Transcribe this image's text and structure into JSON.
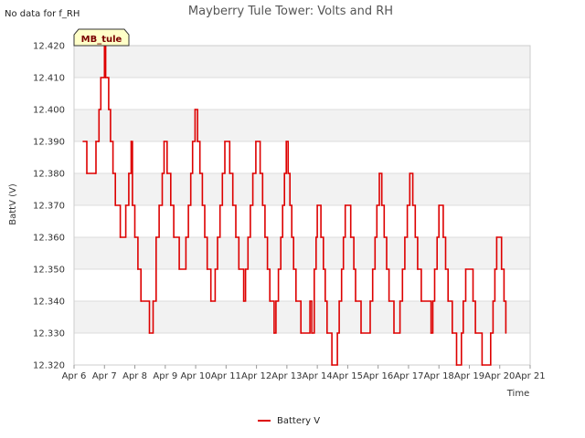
{
  "note": "No data for f_RH",
  "tag": "MB_tule",
  "colors": {
    "series": "#dd0000",
    "band": "#f2f2f2",
    "grid": "#dcdcdc",
    "tag_fill": "#ffffc8"
  },
  "chart_data": {
    "type": "line",
    "title": "Mayberry Tule Tower: Volts and RH",
    "xlabel": "Time",
    "ylabel": "BattV (V)",
    "x_ticks": [
      "Apr 6",
      "Apr 7",
      "Apr 8",
      "Apr 9",
      "Apr 10",
      "Apr 11",
      "Apr 12",
      "Apr 13",
      "Apr 14",
      "Apr 15",
      "Apr 16",
      "Apr 17",
      "Apr 18",
      "Apr 19",
      "Apr 20",
      "Apr 21"
    ],
    "xlim": [
      6,
      21
    ],
    "ylim": [
      12.32,
      12.42
    ],
    "y_ticks": [
      "12.320",
      "12.330",
      "12.340",
      "12.350",
      "12.360",
      "12.370",
      "12.380",
      "12.390",
      "12.400",
      "12.410",
      "12.420"
    ],
    "grid": true,
    "legend_position": "bottom-center",
    "series": [
      {
        "name": "Battery V",
        "x_unit": "day of April",
        "points": [
          [
            6.3,
            12.39
          ],
          [
            6.4,
            12.39
          ],
          [
            6.42,
            12.38
          ],
          [
            6.7,
            12.38
          ],
          [
            6.72,
            12.39
          ],
          [
            6.8,
            12.39
          ],
          [
            6.82,
            12.4
          ],
          [
            6.88,
            12.41
          ],
          [
            6.96,
            12.41
          ],
          [
            7.0,
            12.42
          ],
          [
            7.04,
            12.41
          ],
          [
            7.1,
            12.41
          ],
          [
            7.14,
            12.4
          ],
          [
            7.2,
            12.39
          ],
          [
            7.28,
            12.38
          ],
          [
            7.36,
            12.37
          ],
          [
            7.52,
            12.36
          ],
          [
            7.7,
            12.37
          ],
          [
            7.8,
            12.38
          ],
          [
            7.88,
            12.39
          ],
          [
            7.92,
            12.37
          ],
          [
            8.0,
            12.36
          ],
          [
            8.1,
            12.35
          ],
          [
            8.2,
            12.34
          ],
          [
            8.48,
            12.33
          ],
          [
            8.6,
            12.34
          ],
          [
            8.7,
            12.36
          ],
          [
            8.8,
            12.37
          ],
          [
            8.9,
            12.38
          ],
          [
            8.96,
            12.39
          ],
          [
            9.06,
            12.38
          ],
          [
            9.18,
            12.37
          ],
          [
            9.28,
            12.36
          ],
          [
            9.46,
            12.35
          ],
          [
            9.68,
            12.36
          ],
          [
            9.76,
            12.37
          ],
          [
            9.84,
            12.38
          ],
          [
            9.9,
            12.39
          ],
          [
            9.98,
            12.4
          ],
          [
            10.06,
            12.39
          ],
          [
            10.14,
            12.38
          ],
          [
            10.22,
            12.37
          ],
          [
            10.3,
            12.36
          ],
          [
            10.38,
            12.35
          ],
          [
            10.5,
            12.34
          ],
          [
            10.64,
            12.35
          ],
          [
            10.72,
            12.36
          ],
          [
            10.8,
            12.37
          ],
          [
            10.88,
            12.38
          ],
          [
            10.96,
            12.39
          ],
          [
            11.12,
            12.38
          ],
          [
            11.22,
            12.37
          ],
          [
            11.32,
            12.36
          ],
          [
            11.42,
            12.35
          ],
          [
            11.58,
            12.34
          ],
          [
            11.64,
            12.35
          ],
          [
            11.72,
            12.36
          ],
          [
            11.8,
            12.37
          ],
          [
            11.88,
            12.38
          ],
          [
            11.98,
            12.39
          ],
          [
            12.12,
            12.38
          ],
          [
            12.2,
            12.37
          ],
          [
            12.28,
            12.36
          ],
          [
            12.36,
            12.35
          ],
          [
            12.44,
            12.34
          ],
          [
            12.58,
            12.33
          ],
          [
            12.64,
            12.34
          ],
          [
            12.72,
            12.35
          ],
          [
            12.8,
            12.36
          ],
          [
            12.86,
            12.37
          ],
          [
            12.92,
            12.38
          ],
          [
            12.98,
            12.39
          ],
          [
            13.04,
            12.38
          ],
          [
            13.1,
            12.37
          ],
          [
            13.16,
            12.36
          ],
          [
            13.22,
            12.35
          ],
          [
            13.3,
            12.34
          ],
          [
            13.46,
            12.33
          ],
          [
            13.76,
            12.34
          ],
          [
            13.82,
            12.33
          ],
          [
            13.9,
            12.35
          ],
          [
            13.96,
            12.36
          ],
          [
            14.0,
            12.37
          ],
          [
            14.12,
            12.36
          ],
          [
            14.2,
            12.35
          ],
          [
            14.26,
            12.34
          ],
          [
            14.32,
            12.33
          ],
          [
            14.48,
            12.32
          ],
          [
            14.66,
            12.33
          ],
          [
            14.72,
            12.34
          ],
          [
            14.8,
            12.35
          ],
          [
            14.86,
            12.36
          ],
          [
            14.92,
            12.37
          ],
          [
            15.1,
            12.36
          ],
          [
            15.2,
            12.35
          ],
          [
            15.26,
            12.34
          ],
          [
            15.44,
            12.33
          ],
          [
            15.74,
            12.34
          ],
          [
            15.82,
            12.35
          ],
          [
            15.9,
            12.36
          ],
          [
            15.96,
            12.37
          ],
          [
            16.04,
            12.38
          ],
          [
            16.12,
            12.37
          ],
          [
            16.2,
            12.36
          ],
          [
            16.28,
            12.35
          ],
          [
            16.36,
            12.34
          ],
          [
            16.52,
            12.33
          ],
          [
            16.72,
            12.34
          ],
          [
            16.8,
            12.35
          ],
          [
            16.88,
            12.36
          ],
          [
            16.96,
            12.37
          ],
          [
            17.04,
            12.38
          ],
          [
            17.14,
            12.37
          ],
          [
            17.22,
            12.36
          ],
          [
            17.3,
            12.35
          ],
          [
            17.42,
            12.34
          ],
          [
            17.74,
            12.33
          ],
          [
            17.8,
            12.34
          ],
          [
            17.86,
            12.35
          ],
          [
            17.94,
            12.36
          ],
          [
            18.0,
            12.37
          ],
          [
            18.14,
            12.36
          ],
          [
            18.22,
            12.35
          ],
          [
            18.3,
            12.34
          ],
          [
            18.44,
            12.33
          ],
          [
            18.58,
            12.32
          ],
          [
            18.74,
            12.33
          ],
          [
            18.8,
            12.34
          ],
          [
            18.88,
            12.35
          ],
          [
            19.12,
            12.34
          ],
          [
            19.2,
            12.33
          ],
          [
            19.42,
            12.32
          ],
          [
            19.7,
            12.33
          ],
          [
            19.78,
            12.34
          ],
          [
            19.84,
            12.35
          ],
          [
            19.9,
            12.36
          ],
          [
            20.06,
            12.35
          ],
          [
            20.14,
            12.34
          ],
          [
            20.2,
            12.33
          ]
        ]
      }
    ]
  }
}
